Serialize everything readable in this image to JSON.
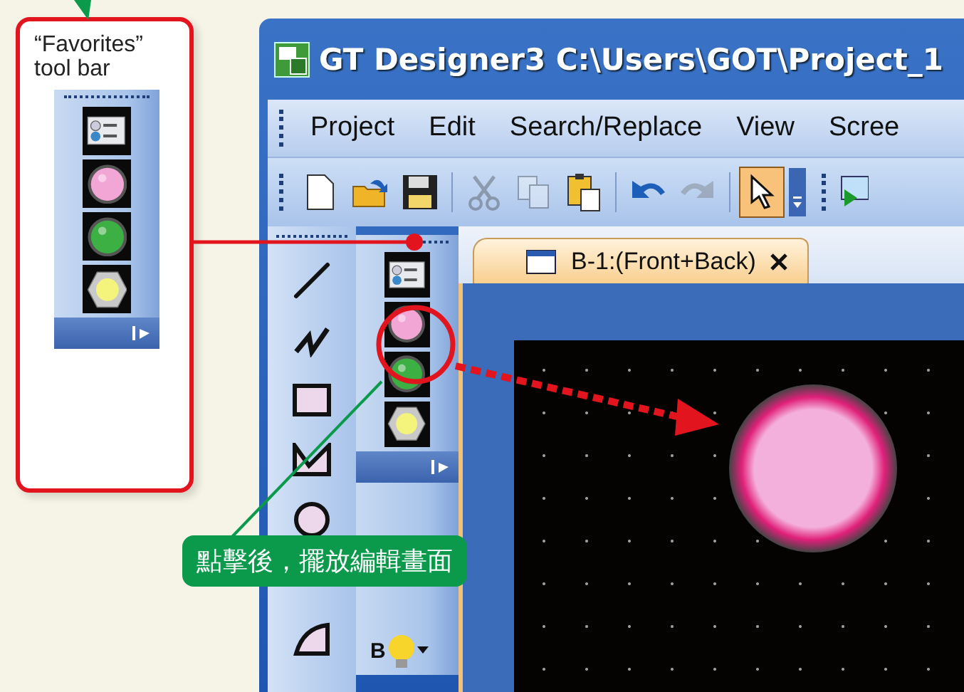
{
  "callout": {
    "title": "“Favorites” tool bar",
    "items": [
      {
        "kind": "switch"
      },
      {
        "kind": "lamp",
        "color": "#f2a6d6"
      },
      {
        "kind": "lamp",
        "color": "#3cb043"
      },
      {
        "kind": "hex_lamp",
        "color": "#f4f47c"
      }
    ]
  },
  "window": {
    "title": "GT Designer3 C:\\Users\\GOT\\Project_1"
  },
  "menu": [
    {
      "label": "Project"
    },
    {
      "label": "Edit"
    },
    {
      "label": "Search/Replace"
    },
    {
      "label": "View"
    },
    {
      "label": "Scree"
    }
  ],
  "toolbar_groups": [
    [
      {
        "kind": "new",
        "disabled": false,
        "selected": false
      },
      {
        "kind": "open",
        "disabled": false,
        "selected": false
      },
      {
        "kind": "save",
        "disabled": false,
        "selected": false
      }
    ],
    [
      {
        "kind": "cut",
        "disabled": true,
        "selected": false
      },
      {
        "kind": "copy",
        "disabled": true,
        "selected": false
      },
      {
        "kind": "paste",
        "disabled": false,
        "selected": false
      }
    ],
    [
      {
        "kind": "undo",
        "disabled": false,
        "selected": false
      },
      {
        "kind": "redo",
        "disabled": true,
        "selected": false
      }
    ],
    [
      {
        "kind": "pointer",
        "disabled": false,
        "selected": true
      }
    ]
  ],
  "drawing_tools": [
    {
      "kind": "line"
    },
    {
      "kind": "polyline"
    },
    {
      "kind": "rectangle"
    },
    {
      "kind": "polygon"
    },
    {
      "kind": "circle"
    },
    {
      "kind": "blank"
    },
    {
      "kind": "sector"
    }
  ],
  "favorites_tools": [
    {
      "kind": "switch"
    },
    {
      "kind": "lamp",
      "color": "#f2a6d6"
    },
    {
      "kind": "lamp",
      "color": "#3cb043"
    },
    {
      "kind": "hex_lamp",
      "color": "#f4f47c"
    }
  ],
  "bulb_tool": {
    "letter": "B"
  },
  "tab": {
    "label": "B-1:(Front+Back)",
    "selected": true
  },
  "canvas": {
    "objects": [
      {
        "kind": "lamp",
        "color": "#f4b0dc"
      }
    ]
  },
  "annotation": {
    "label": "點擊後，擺放編輯畫面"
  }
}
